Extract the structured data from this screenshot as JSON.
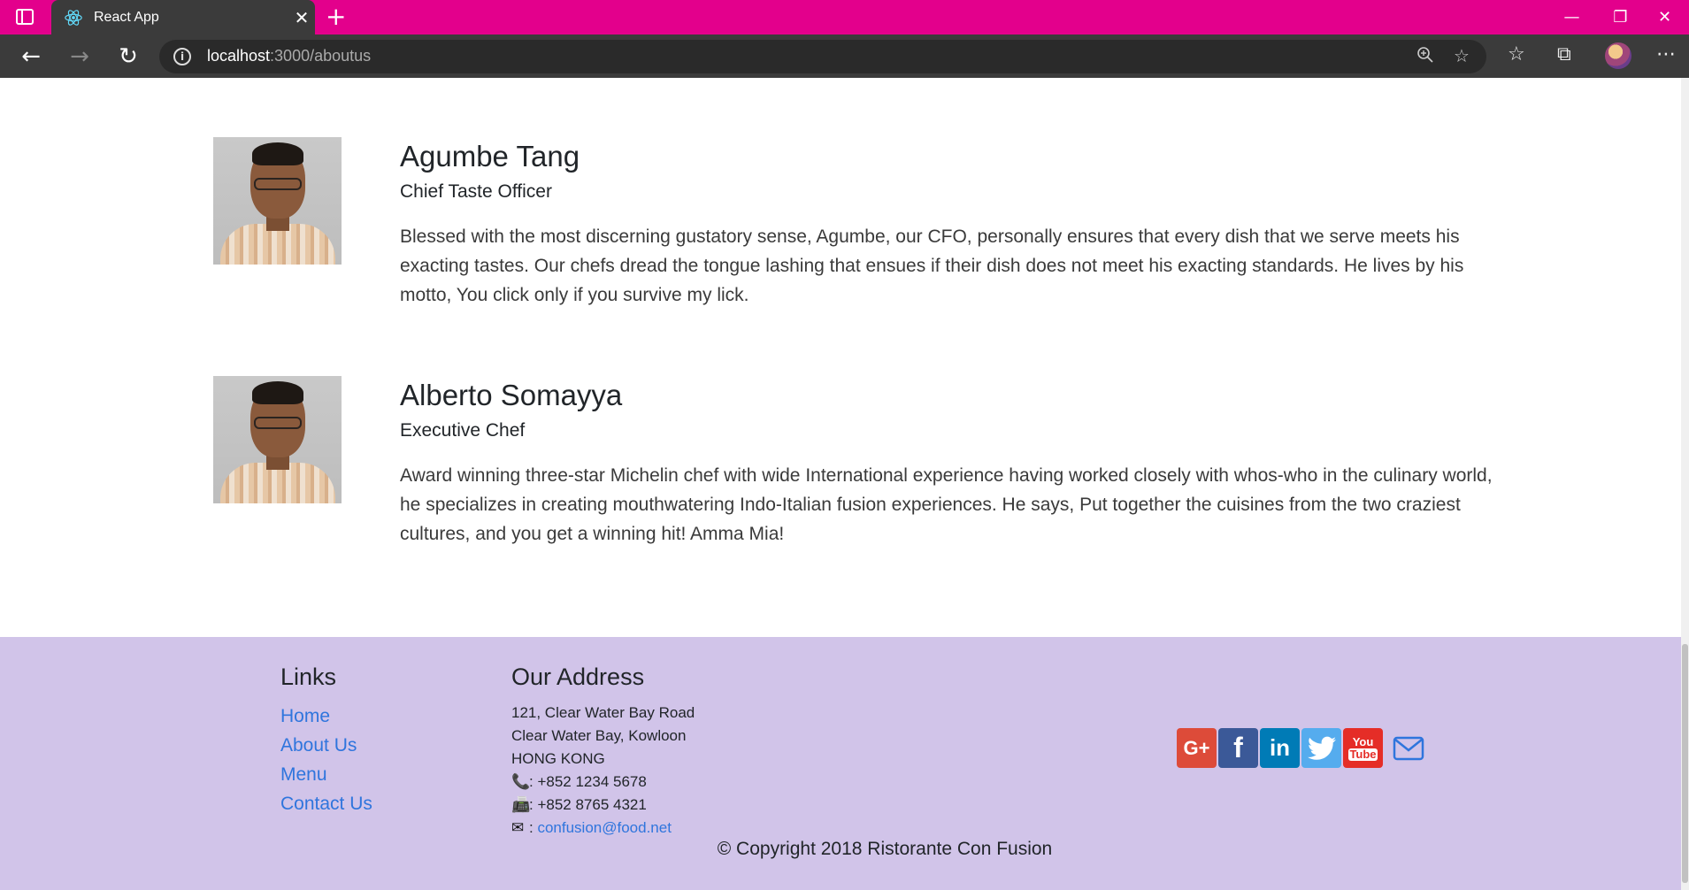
{
  "browser": {
    "tab_title": "React App",
    "tab_close": "✕",
    "new_tab": "+",
    "url_host": "localhost",
    "url_path": ":3000/aboutus",
    "window_controls": {
      "minimize": "—",
      "restore": "❐",
      "close": "✕"
    },
    "accent_color": "#e3008c"
  },
  "leaders": [
    {
      "name": "Agumbe Tang",
      "designation": "Chief Taste Officer",
      "description": "Blessed with the most discerning gustatory sense, Agumbe, our CFO, personally ensures that every dish that we serve meets his exacting tastes. Our chefs dread the tongue lashing that ensues if their dish does not meet his exacting standards. He lives by his motto, You click only if you survive my lick."
    },
    {
      "name": "Alberto Somayya",
      "designation": "Executive Chef",
      "description": "Award winning three-star Michelin chef with wide International experience having worked closely with whos-who in the culinary world, he specializes in creating mouthwatering Indo-Italian fusion experiences. He says, Put together the cuisines from the two craziest cultures, and you get a winning hit! Amma Mia!"
    }
  ],
  "footer": {
    "links_heading": "Links",
    "links": [
      "Home",
      "About Us",
      "Menu",
      "Contact Us"
    ],
    "address_heading": "Our Address",
    "address_lines": [
      "121, Clear Water Bay Road",
      "Clear Water Bay, Kowloon",
      "HONG KONG"
    ],
    "phone": ": +852 1234 5678",
    "fax": ": +852 8765 4321",
    "email_prefix": ": ",
    "email": "confusion@food.net",
    "social": {
      "google": "G+",
      "facebook": "f",
      "linkedin": "in",
      "youtube_top": "You",
      "youtube_bottom": "Tube"
    },
    "copyright": "© Copyright 2018 Ristorante Con Fusion",
    "background": "#d1c4e9",
    "link_color": "#2f75dd"
  }
}
